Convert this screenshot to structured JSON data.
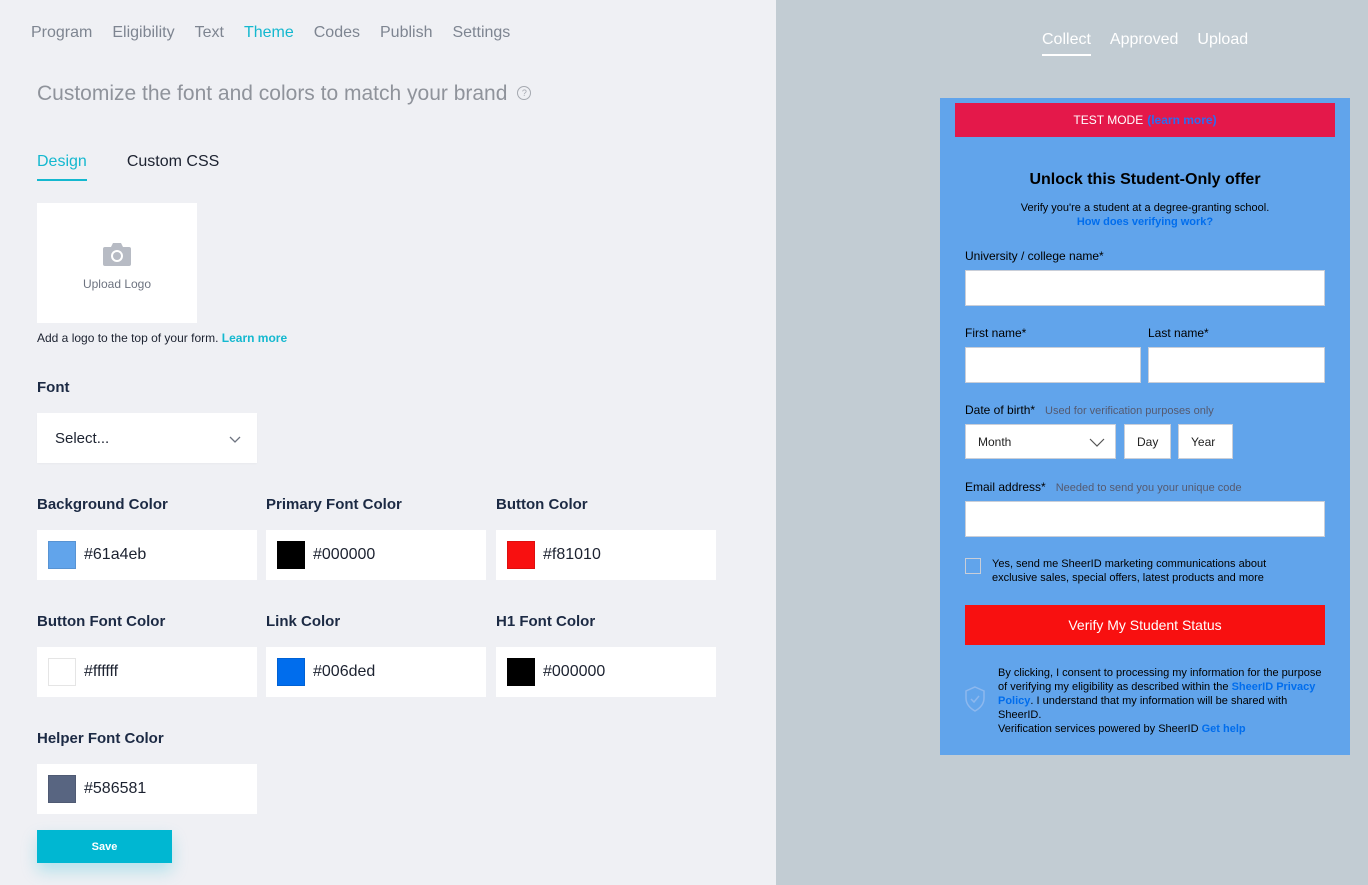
{
  "nav": {
    "items": [
      "Program",
      "Eligibility",
      "Text",
      "Theme",
      "Codes",
      "Publish",
      "Settings"
    ],
    "active": "Theme"
  },
  "heading": "Customize the font and colors to match your brand",
  "help_icon": "?",
  "subtabs": [
    "Design",
    "Custom CSS"
  ],
  "upload": {
    "label": "Upload Logo",
    "icon": "camera-icon",
    "help_text": "Add a logo to the top of your form.",
    "help_link": "Learn more"
  },
  "font": {
    "label": "Font",
    "value": "Select..."
  },
  "colors": [
    {
      "label": "Background Color",
      "value": "#61a4eb"
    },
    {
      "label": "Primary Font Color",
      "value": "#000000"
    },
    {
      "label": "Button Color",
      "value": "#f81010"
    },
    {
      "label": "Button Font Color",
      "value": "#ffffff"
    },
    {
      "label": "Link Color",
      "value": "#006ded"
    },
    {
      "label": "H1 Font Color",
      "value": "#000000"
    },
    {
      "label": "Helper Font Color",
      "value": "#586581"
    }
  ],
  "save_label": "Save",
  "preview": {
    "tabs": [
      "Collect",
      "Approved",
      "Upload"
    ],
    "test_mode": "TEST MODE",
    "test_mode_link": "(learn more)",
    "title": "Unlock this Student-Only offer",
    "subtitle": "Verify you're a student at a degree-granting school.",
    "how_link": "How does verifying work?",
    "university_label": "University / college name*",
    "first_name_label": "First name*",
    "last_name_label": "Last name*",
    "dob_label": "Date of birth*",
    "dob_hint": "Used for verification purposes only",
    "month_placeholder": "Month",
    "day_placeholder": "Day",
    "year_placeholder": "Year",
    "email_label": "Email address*",
    "email_hint": "Needed to send you your unique code",
    "marketing_text": "Yes, send me SheerID marketing communications about exclusive sales, special offers, latest products and more",
    "verify_button": "Verify My Student Status",
    "consent_1": "By clicking, I consent to processing my information for the purpose of verifying my eligibility as described within the",
    "consent_link": "SheerID Privacy Policy",
    "consent_2": ". I understand that my information will be shared with SheerID.",
    "powered_text": "Verification services powered by SheerID",
    "help_link": "Get help"
  }
}
